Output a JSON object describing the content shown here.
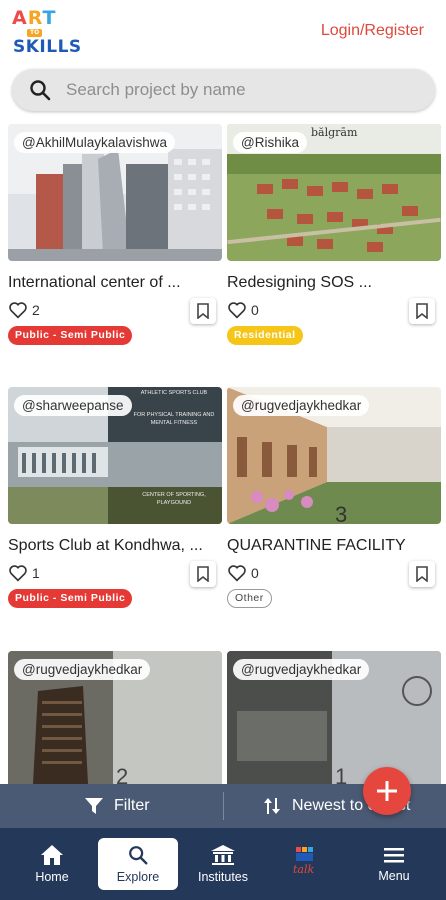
{
  "header": {
    "logo": {
      "line1": [
        "A",
        "R",
        "T"
      ],
      "line2": "TO",
      "line3": "SKILLS"
    },
    "login_label": "Login/Register"
  },
  "search": {
    "placeholder": "Search project by name",
    "value": ""
  },
  "projects": [
    {
      "user": "@AkhilMulaykalavishwa",
      "title": "International center of ...",
      "likes": "2",
      "category": "Public - Semi Public",
      "category_style": "red"
    },
    {
      "user": "@Rishika",
      "title": "Redesigning SOS ...",
      "likes": "0",
      "category": "Residential",
      "category_style": "yellow"
    },
    {
      "user": "@sharweepanse",
      "title": "Sports Club at Kondhwa, ...",
      "likes": "1",
      "category": "Public - Semi Public",
      "category_style": "red"
    },
    {
      "user": "@rugvedjaykhedkar",
      "title": "QUARANTINE FACILITY",
      "likes": "0",
      "category": "Other",
      "category_style": "outline"
    },
    {
      "user": "@rugvedjaykhedkar",
      "title": "",
      "likes": "",
      "category": "",
      "category_style": ""
    },
    {
      "user": "@rugvedjaykhedkar",
      "title": "",
      "likes": "",
      "category": "",
      "category_style": ""
    }
  ],
  "thumb_text": {
    "card2": "bălgrām",
    "card3_lines": [
      "ATHLETIC SPORTS CLUB",
      "FOR PHYSICAL TRAINING AND MENTAL FITNESS",
      "CENTER OF SPORTING, PLAYGOUND"
    ]
  },
  "filterbar": {
    "filter_label": "Filter",
    "sort_label": "Newest to oldest"
  },
  "fab": {
    "icon": "plus-icon"
  },
  "bottomnav": {
    "items": [
      {
        "label": "Home",
        "icon": "home-icon"
      },
      {
        "label": "Explore",
        "icon": "search-icon",
        "active": true
      },
      {
        "label": "Institutes",
        "icon": "institution-icon"
      },
      {
        "label": "",
        "icon": "talk-logo-icon"
      },
      {
        "label": "Menu",
        "icon": "menu-icon"
      }
    ]
  },
  "colors": {
    "accent": "#e5463e",
    "nav_bg": "#24385a",
    "filter_bg": "#4b5a74",
    "search_bg": "#e6e6e6"
  }
}
